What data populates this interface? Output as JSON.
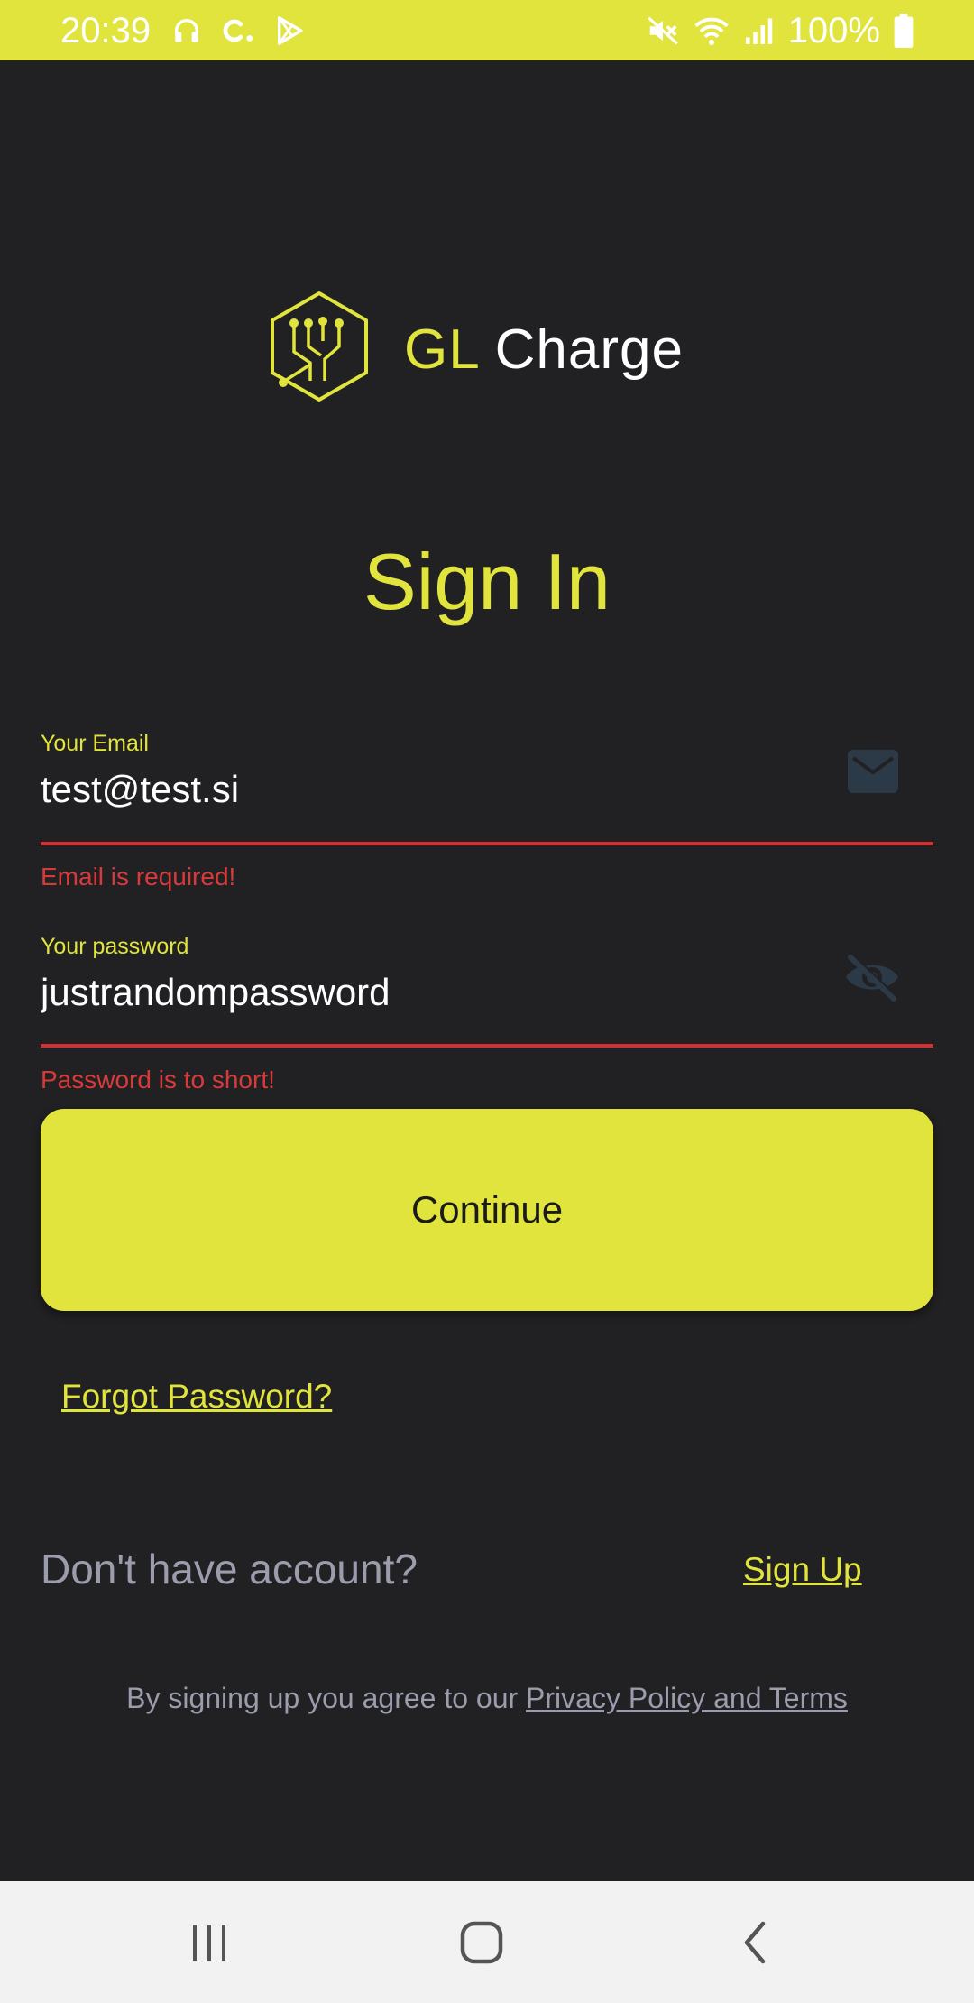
{
  "status_bar": {
    "time": "20:39",
    "battery": "100%",
    "icons_left": [
      "headphones-icon",
      "carrier-c-icon",
      "play-store-icon"
    ],
    "icons_right": [
      "mute-icon",
      "wifi-icon",
      "signal-icon",
      "battery-icon"
    ]
  },
  "logo": {
    "part1": "GL",
    "part2": "Charge"
  },
  "page": {
    "title": "Sign In"
  },
  "email": {
    "label": "Your Email",
    "value": "test@test.si",
    "error": "Email is required!",
    "icon": "mail-icon"
  },
  "password": {
    "label": "Your password",
    "value": "justrandompassword",
    "error": "Password is to short!",
    "icon": "eye-off-icon"
  },
  "actions": {
    "continue": "Continue",
    "forgot": "Forgot Password?",
    "no_account": "Don't have account?",
    "signup": "Sign Up"
  },
  "terms": {
    "prefix": "By signing up you agree to our ",
    "link": "Privacy Policy and Terms"
  },
  "colors": {
    "accent": "#e1e43c",
    "background": "#212123",
    "error": "#d32f2f",
    "muted": "#9b9cac"
  }
}
